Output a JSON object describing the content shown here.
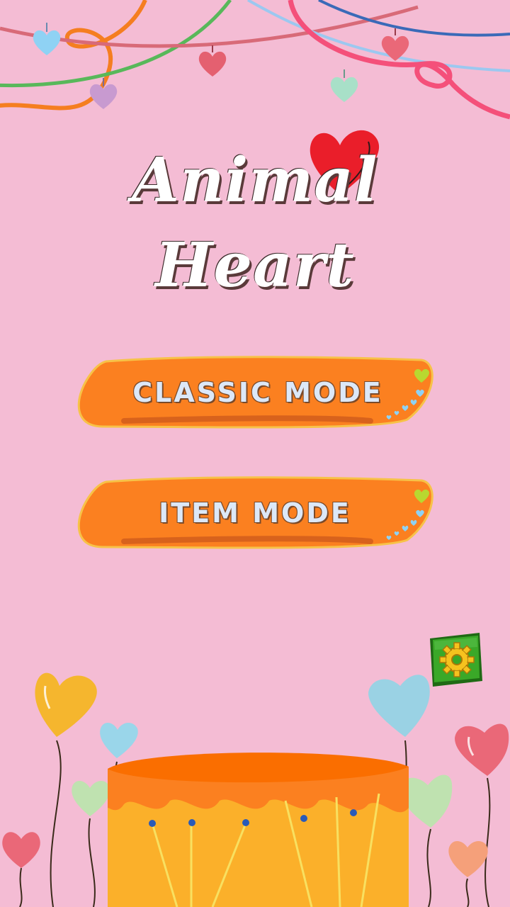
{
  "game": {
    "title": "Animal Heart",
    "buttons": {
      "classic_mode": "CLASSIC MODE",
      "item_mode": "ITEM MODE"
    },
    "settings_icon": "gear-icon"
  },
  "colors": {
    "background": "#f4bcd4",
    "button_fill": "#fb8020",
    "button_border": "#f7c248",
    "button_text": "#dce8f8",
    "title_heart": "#ea1e2a",
    "settings_box": "#2f9a1e",
    "gear": "#f6c21e",
    "drum_top": "#fa6e00",
    "drum_body": "#fbb02a"
  }
}
